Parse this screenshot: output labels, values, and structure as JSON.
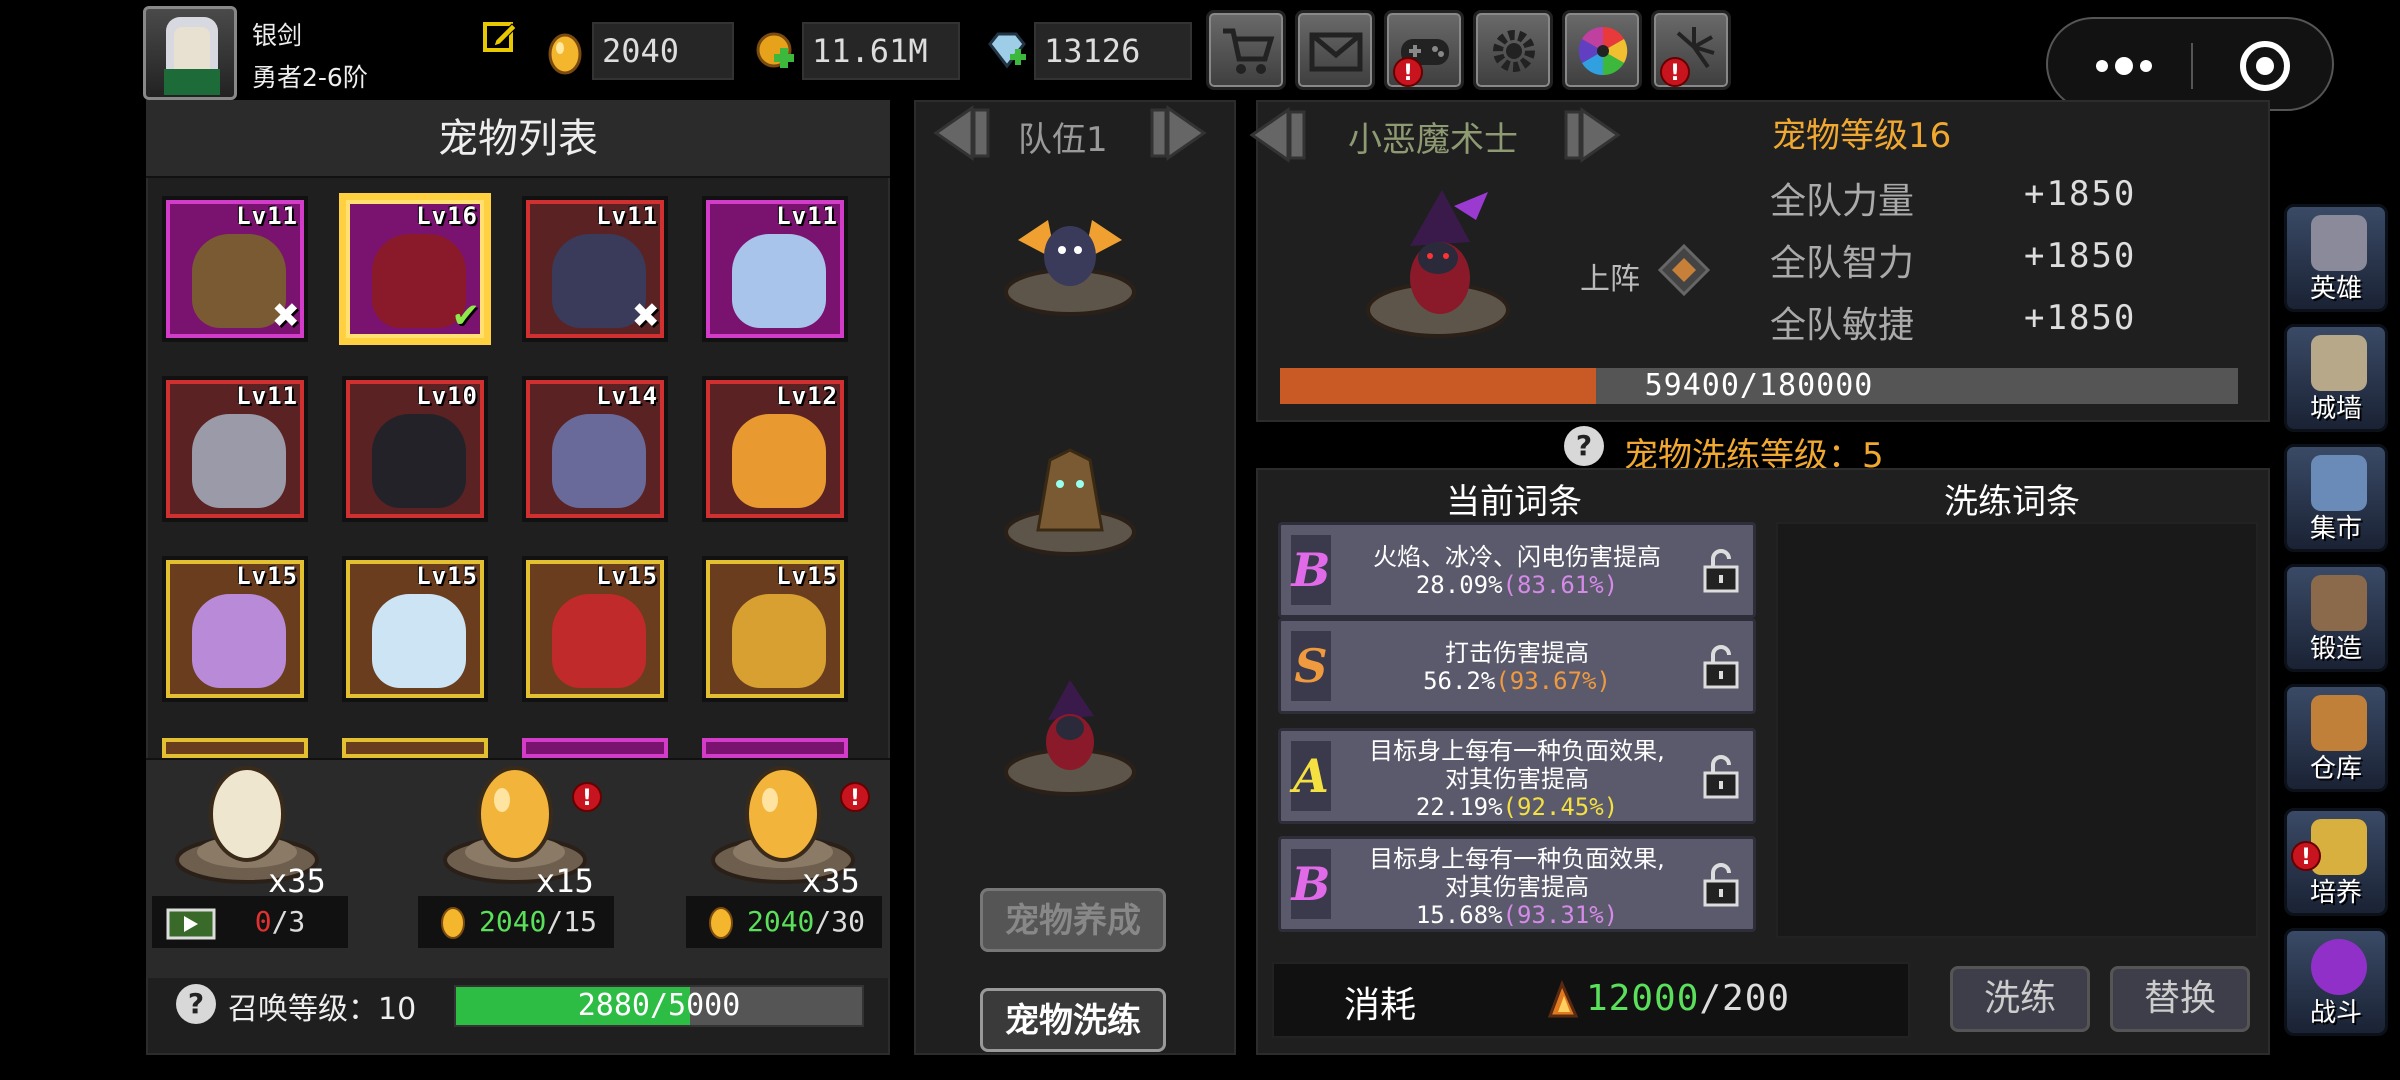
{
  "player": {
    "name": "银剑",
    "rank": "勇者2-6阶"
  },
  "resources": {
    "gold": "2040",
    "coins": "11.61M",
    "gems": "13126"
  },
  "top_buttons": [
    "shop",
    "mail",
    "gamepad",
    "settings",
    "color-wheel",
    "fireworks"
  ],
  "pet_list": {
    "title": "宠物列表",
    "pets": [
      {
        "level": "Lv11",
        "rarity": "purple",
        "sprite": "treant",
        "mark": "x"
      },
      {
        "level": "Lv16",
        "rarity": "purple",
        "sprite": "wizard",
        "mark": "check",
        "selected": true
      },
      {
        "level": "Lv11",
        "rarity": "red",
        "sprite": "bat",
        "mark": "x"
      },
      {
        "level": "Lv11",
        "rarity": "purple",
        "sprite": "ghost-unicorn",
        "mark": ""
      },
      {
        "level": "Lv11",
        "rarity": "red",
        "sprite": "grey-bat",
        "mark": ""
      },
      {
        "level": "Lv10",
        "rarity": "red",
        "sprite": "reaper",
        "mark": ""
      },
      {
        "level": "Lv14",
        "rarity": "red",
        "sprite": "unicorn",
        "mark": ""
      },
      {
        "level": "Lv12",
        "rarity": "red",
        "sprite": "fire-skull",
        "mark": ""
      },
      {
        "level": "Lv15",
        "rarity": "gold",
        "sprite": "scorpion",
        "mark": ""
      },
      {
        "level": "Lv15",
        "rarity": "gold",
        "sprite": "ice-wolf",
        "mark": ""
      },
      {
        "level": "Lv15",
        "rarity": "gold",
        "sprite": "lava-beast",
        "mark": ""
      },
      {
        "level": "Lv15",
        "rarity": "gold",
        "sprite": "turtle",
        "mark": ""
      }
    ]
  },
  "eggs": [
    {
      "count": "x35",
      "cost_current": "0",
      "cost_total": "/3",
      "cost_type": "ad"
    },
    {
      "count": "x15",
      "cost_current": "2040",
      "cost_total": "/15",
      "cost_type": "gold"
    },
    {
      "count": "x35",
      "cost_current": "2040",
      "cost_total": "/30",
      "cost_type": "gold"
    }
  ],
  "summon": {
    "label": "召唤等级：10",
    "progress_text": "2880/5000",
    "progress": 0.576
  },
  "team": {
    "label": "队伍1",
    "buttons": {
      "nurture": "宠物养成",
      "wash": "宠物洗练"
    }
  },
  "pet_detail": {
    "name": "小恶魔术士",
    "level_text": "宠物等级16",
    "deploy_label": "上阵",
    "stats": [
      {
        "name": "全队力量",
        "value": "+1850"
      },
      {
        "name": "全队智力",
        "value": "+1850"
      },
      {
        "name": "全队敏捷",
        "value": "+1850"
      }
    ],
    "exp_text": "59400/180000",
    "exp_progress": 0.33
  },
  "wash": {
    "level_text": "宠物洗练等级：5",
    "current_header": "当前词条",
    "wash_header": "洗练词条",
    "affixes": [
      {
        "grade": "B",
        "line1": "火焰、冰冷、闪电伤害提高",
        "line2": "",
        "value": "28.09%",
        "max": "(83.61%)"
      },
      {
        "grade": "S",
        "line1": "打击伤害提高",
        "line2": "",
        "value": "56.2%",
        "max": "(93.67%)"
      },
      {
        "grade": "A",
        "line1": "目标身上每有一种负面效果,",
        "line2": "对其伤害提高",
        "value": "22.19%",
        "max": "(92.45%)"
      },
      {
        "grade": "B",
        "line1": "目标身上每有一种负面效果,",
        "line2": "对其伤害提高",
        "value": "15.68%",
        "max": "(93.31%)"
      }
    ],
    "cost_label": "消耗",
    "cost_current": "12000",
    "cost_total": "/200",
    "wash_button": "洗练",
    "replace_button": "替换"
  },
  "sidebar": [
    {
      "label": "英雄",
      "icon": "helmet-icon"
    },
    {
      "label": "城墙",
      "icon": "castle-icon"
    },
    {
      "label": "集市",
      "icon": "market-icon"
    },
    {
      "label": "锻造",
      "icon": "anvil-icon"
    },
    {
      "label": "仓库",
      "icon": "chest-icon"
    },
    {
      "label": "培养",
      "icon": "trophy-icon"
    },
    {
      "label": "战斗",
      "icon": "portal-icon"
    }
  ],
  "colors": {
    "gold": "#f0a830",
    "green": "#5be05b",
    "exp": "#c95a25",
    "summon": "#2ebd44"
  }
}
